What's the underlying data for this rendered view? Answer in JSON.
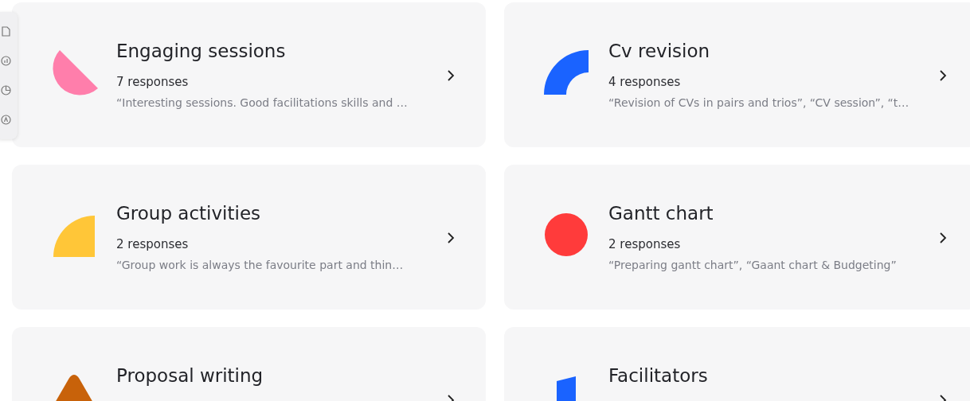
{
  "toolbar": {
    "items": [
      {
        "kind": "page"
      },
      {
        "kind": "bar-chart"
      },
      {
        "kind": "pie-chart"
      },
      {
        "kind": "badge"
      }
    ]
  },
  "cards": [
    {
      "title": "Engaging sessions",
      "responses": "7 responses",
      "quote": "“Interesting sessions. Good facilitations skills and …",
      "shape": {
        "kind": "half-disc",
        "color": "#ff7eab"
      }
    },
    {
      "title": "Cv revision",
      "responses": "4 responses",
      "quote": "“Revision of CVs in pairs and trios”, “CV session”, “t…",
      "shape": {
        "kind": "quarter-ring",
        "color": "#1a63ff"
      }
    },
    {
      "title": "Group activities",
      "responses": "2 responses",
      "quote": "“Group work is always the favourite part and thin…",
      "shape": {
        "kind": "quarter-disc",
        "color": "#ffc638"
      }
    },
    {
      "title": "Gantt chart",
      "responses": "2 responses",
      "quote": "“Preparing gantt chart”, “Gaant chart & Budgeting”",
      "shape": {
        "kind": "circle",
        "color": "#ff3b3b"
      }
    },
    {
      "title": "Proposal writing",
      "shape": {
        "kind": "roof",
        "color": "#c8620a"
      }
    },
    {
      "title": "Facilitators",
      "shape": {
        "kind": "slab",
        "color": "#1a63ff"
      }
    }
  ]
}
